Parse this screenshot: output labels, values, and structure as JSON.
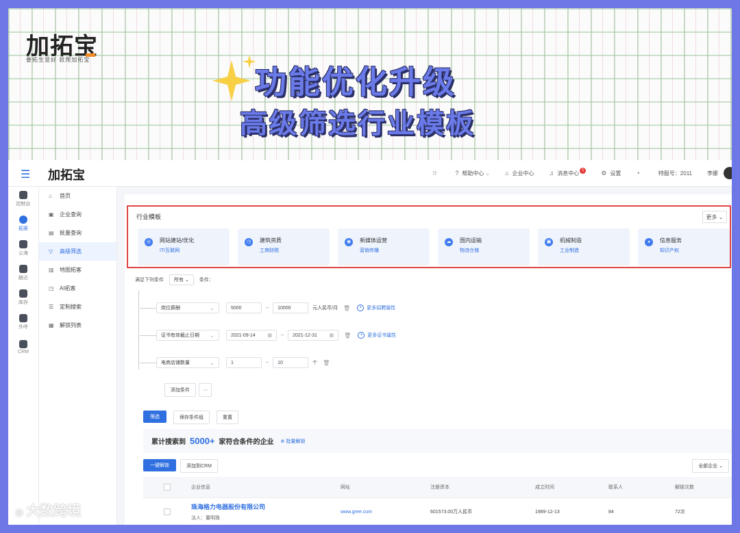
{
  "promo": {
    "logo": "加拓宝",
    "slogan": "要拓生意好  就用加拓宝",
    "title": "功能优化升级",
    "subtitle": "高级筛选行业模板"
  },
  "header": {
    "logo": "加拓宝",
    "nav": [
      {
        "icon": "grid-icon",
        "label": ""
      },
      {
        "icon": "help-icon",
        "label": "帮助中心"
      },
      {
        "icon": "home-icon",
        "label": "企业中心"
      },
      {
        "icon": "bell-icon",
        "label": "消息中心",
        "badge": "1"
      },
      {
        "icon": "gear-icon",
        "label": "设置"
      },
      {
        "icon": "headset-icon",
        "label": ""
      },
      {
        "icon": "",
        "label": "特服号：2011"
      },
      {
        "icon": "",
        "label": "李娜"
      }
    ]
  },
  "rail": [
    {
      "label": "控制台",
      "icon": "dashboard-icon",
      "active": false
    },
    {
      "label": "拓客",
      "icon": "explore-icon",
      "active": true
    },
    {
      "label": "公海",
      "icon": "sea-icon",
      "active": false
    },
    {
      "label": "触达",
      "icon": "reach-icon",
      "active": false
    },
    {
      "label": "库存",
      "icon": "stock-icon",
      "active": false
    },
    {
      "label": "外呼",
      "icon": "robot-icon",
      "active": false
    },
    {
      "label": "CRM",
      "icon": "crm-icon",
      "active": false
    }
  ],
  "submenu": [
    {
      "label": "首页",
      "icon": "⌂",
      "active": false
    },
    {
      "label": "企业查询",
      "icon": "▣",
      "active": false
    },
    {
      "label": "批量查询",
      "icon": "▤",
      "active": false
    },
    {
      "label": "高级筛选",
      "icon": "▽",
      "active": true
    },
    {
      "label": "地图拓客",
      "icon": "▥",
      "active": false
    },
    {
      "label": "AI拓客",
      "icon": "◳",
      "active": false
    },
    {
      "label": "定制搜索",
      "icon": "☰",
      "active": false
    },
    {
      "label": "解锁列表",
      "icon": "▦",
      "active": false
    }
  ],
  "templates": {
    "title": "行业模板",
    "more": "更多 ⌄",
    "cards": [
      {
        "name": "网站建站/优化",
        "sub": "IT/互联网"
      },
      {
        "name": "建筑资质",
        "sub": "工商财税"
      },
      {
        "name": "新媒体运营",
        "sub": "营销传播"
      },
      {
        "name": "国内运输",
        "sub": "物流仓储"
      },
      {
        "name": "机械制造",
        "sub": "工业制造"
      },
      {
        "name": "信息服务",
        "sub": "知识产权"
      }
    ]
  },
  "conditions": {
    "prefix": "满足下列条件",
    "match": "所有",
    "suffix": "条件：",
    "rows": [
      {
        "field": "岗位薪酬",
        "from": "5000",
        "to": "10000",
        "unit": "元人民币/月",
        "more": "更多招聘属性"
      },
      {
        "field": "证书有效截止日期",
        "from": "2021-09-14",
        "to": "2021-12-31",
        "unit": "",
        "more": "更多证书属性"
      },
      {
        "field": "电商店铺数量",
        "from": "1",
        "to": "10",
        "unit": "个",
        "more": ""
      }
    ],
    "add": "添加条件",
    "add_more": "···"
  },
  "actions": {
    "filter": "筛选",
    "save": "保存条件组",
    "reset": "重置"
  },
  "result": {
    "prefix": "累计搜索到",
    "count": "5000+",
    "suffix": "家符合条件的企业",
    "unlock": "批量解锁"
  },
  "bulk": {
    "unlock_all": "一键解锁",
    "add_crm": "添加到CRM",
    "scope": "全部企业 ⌄"
  },
  "table": {
    "headers": [
      "企业信息",
      "网址",
      "注册资本",
      "成立时间",
      "联系人",
      "解锁次数"
    ],
    "rows": [
      {
        "name": "珠海格力电器股份有限公司",
        "legal": "法人：董明珠",
        "website": "www.gree.com",
        "capital": "601573.00万人民币",
        "founded": "1989-12-13",
        "contacts": "84",
        "unlocks": "72次"
      }
    ]
  },
  "watermark": "大数跨境"
}
